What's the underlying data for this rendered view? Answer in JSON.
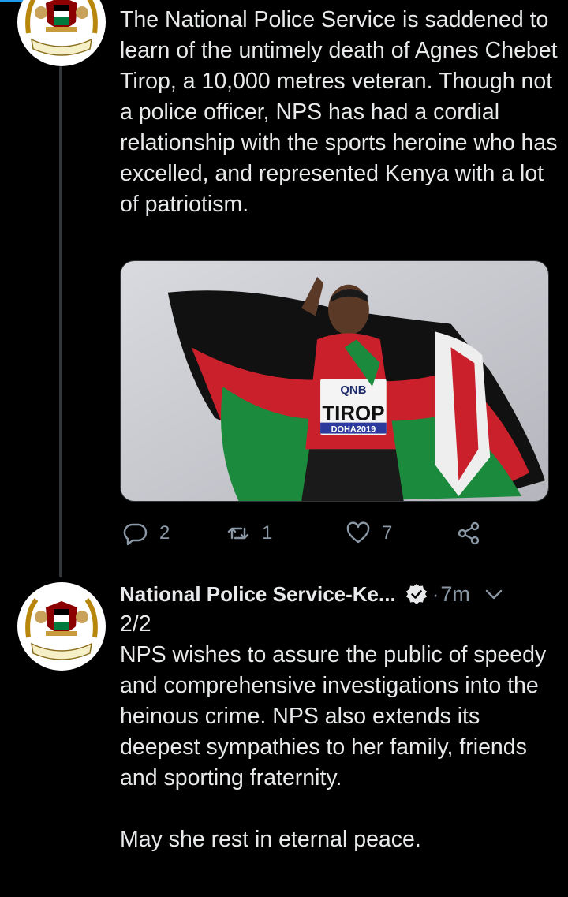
{
  "colors": {
    "background": "#000000",
    "text": "#e7e9ea",
    "muted": "#8b98a5",
    "accent": "#1d9bf0",
    "thread_line": "#333639"
  },
  "tweet1": {
    "avatar_icon": "police-crest-avatar",
    "text": "The National Police Service is saddened to learn of the untimely death of Agnes Chebet Tirop, a 10,000 metres veteran. Though not a police officer, NPS  has had a cordial relationship with the sports heroine who has excelled, and represented Kenya with a lot of patriotism.",
    "media": {
      "sponsor": "QNB",
      "bib_name": "TIROP",
      "event": "DOHA2019"
    },
    "actions": {
      "reply_count": "2",
      "retweet_count": "1",
      "like_count": "7"
    }
  },
  "tweet2": {
    "avatar_icon": "police-crest-avatar",
    "display_name": "National Police Service-Ke...",
    "time_separator": "·",
    "time": "7m",
    "lines": [
      "2/2",
      "NPS wishes to assure the public of speedy and comprehensive investigations into the heinous crime. NPS also extends its deepest sympathies to her family, friends and sporting fraternity.",
      "",
      "May she rest in eternal peace."
    ]
  }
}
